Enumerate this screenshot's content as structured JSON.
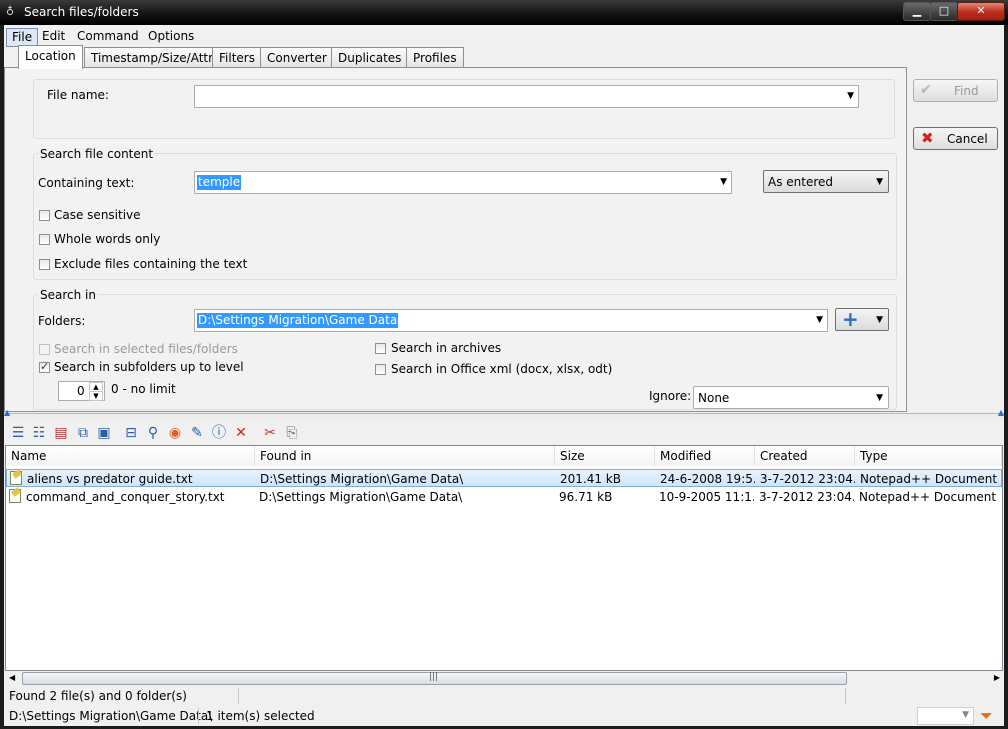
{
  "window": {
    "title": "Search files/folders"
  },
  "menu": [
    "File",
    "Edit",
    "Command",
    "Options"
  ],
  "tabs": [
    "Location",
    "Timestamp/Size/Attr",
    "Filters",
    "Converter",
    "Duplicates",
    "Profiles"
  ],
  "location": {
    "file_name_label": "File name:",
    "file_name_value": ""
  },
  "content": {
    "group_label": "Search file content",
    "containing_label": "Containing text:",
    "containing_value": "temple",
    "match_mode": "As entered",
    "case_sensitive": "Case sensitive",
    "whole_words": "Whole words only",
    "exclude": "Exclude files containing the text"
  },
  "search_in": {
    "group_label": "Search in",
    "folders_label": "Folders:",
    "folders_value": "D:\\Settings Migration\\Game Data",
    "selected_files": "Search in selected files/folders",
    "subfolders": "Search in subfolders up to level",
    "level_value": "0",
    "level_hint": "0 - no limit",
    "archives": "Search in archives",
    "office": "Search in Office xml (docx, xlsx, odt)",
    "ignore_label": "Ignore:",
    "ignore_value": "None"
  },
  "buttons": {
    "find": "Find",
    "cancel": "Cancel"
  },
  "table": {
    "columns": [
      "Name",
      "Found in",
      "Size",
      "Modified",
      "Created",
      "Type"
    ],
    "rows": [
      {
        "name": "aliens vs predator guide.txt",
        "found_in": "D:\\Settings Migration\\Game Data\\",
        "size": "201.41 kB",
        "modified": "24-6-2008 19:5...",
        "created": "3-7-2012 23:04...",
        "type": "Notepad++ Document"
      },
      {
        "name": "command_and_conquer_story.txt",
        "found_in": "D:\\Settings Migration\\Game Data\\",
        "size": "96.71 kB",
        "modified": "10-9-2005 11:1...",
        "created": "3-7-2012 23:04...",
        "type": "Notepad++ Document"
      }
    ]
  },
  "status": {
    "found": "Found 2 file(s) and 0 folder(s)",
    "path": "D:\\Settings Migration\\Game Data\\",
    "selected": "1 item(s) selected"
  }
}
